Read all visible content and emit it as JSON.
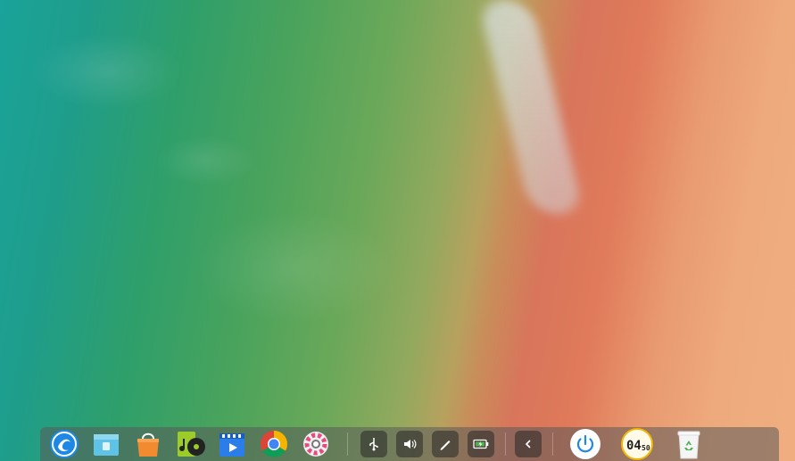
{
  "desktop": {
    "wallpaper": "beach-aerial-wallpaper"
  },
  "dock": {
    "apps": [
      {
        "name": "deepin-launcher",
        "icon": "launcher-icon"
      },
      {
        "name": "file-manager",
        "icon": "file-manager-icon"
      },
      {
        "name": "app-store",
        "icon": "app-store-icon"
      },
      {
        "name": "music",
        "icon": "music-icon"
      },
      {
        "name": "movie-player",
        "icon": "movie-icon"
      },
      {
        "name": "chrome",
        "icon": "chrome-icon"
      },
      {
        "name": "settings",
        "icon": "settings-icon"
      }
    ],
    "tray": [
      {
        "name": "usb",
        "icon": "usb-icon"
      },
      {
        "name": "volume",
        "icon": "volume-icon"
      },
      {
        "name": "pen",
        "icon": "pen-icon"
      },
      {
        "name": "battery",
        "icon": "battery-icon"
      },
      {
        "name": "collapse",
        "icon": "chevron-left-icon"
      }
    ],
    "system": {
      "power_icon": "power-icon",
      "clock": {
        "hour": "04",
        "minute": "50"
      },
      "trash_icon": "trash-icon"
    }
  },
  "colors": {
    "dock_bg": "#5a5a5a",
    "launcher_blue": "#1e88e5",
    "chrome_red": "#db4437",
    "chrome_yellow": "#f4b400",
    "chrome_green": "#0f9d58",
    "chrome_blue": "#4285f4",
    "music_green": "#9ccc2a"
  }
}
